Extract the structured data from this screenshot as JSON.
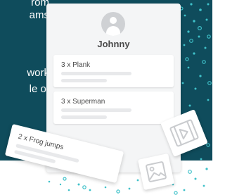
{
  "side_text": {
    "line1": "rom",
    "line2": "ams",
    "line3": "work",
    "line4": "le of"
  },
  "profile": {
    "name": "Johnny",
    "avatar_icon": "user-avatar-icon"
  },
  "exercises": [
    {
      "label": "3 x Plank"
    },
    {
      "label": "3 x Superman"
    }
  ],
  "dragged_exercise": {
    "label": "2 x Frog jumps"
  },
  "media_tiles": [
    {
      "icon": "video-icon"
    },
    {
      "icon": "image-icon"
    }
  ],
  "colors": {
    "background": "#0f4c5c",
    "dots": "#3fc1c9",
    "card": "#f4f5f6"
  }
}
